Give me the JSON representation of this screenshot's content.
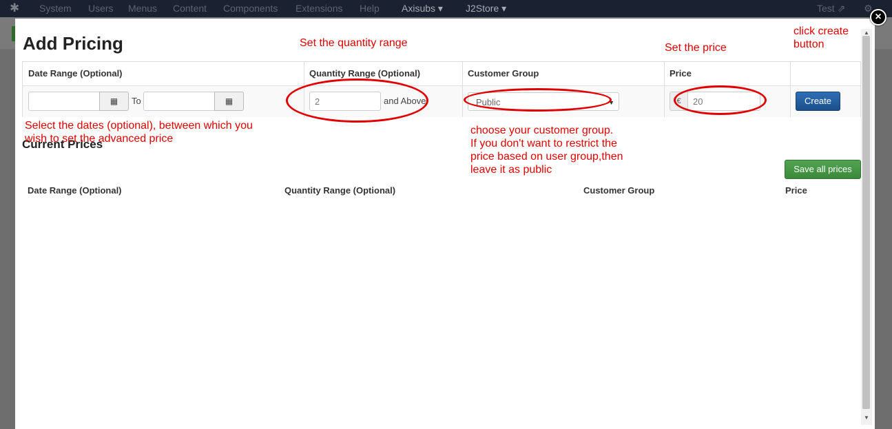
{
  "topbar": {
    "items": [
      "System",
      "Users",
      "Menus",
      "Content",
      "Components",
      "Extensions",
      "Help"
    ],
    "menu_axisubs": "Axisubs",
    "menu_j2store": "J2Store",
    "user": "Test"
  },
  "modal": {
    "title": "Add Pricing",
    "close_glyph": "×",
    "add_table": {
      "headers": {
        "date_range": "Date Range (Optional)",
        "quantity_range": "Quantity Range (Optional)",
        "customer_group": "Customer Group",
        "price": "Price"
      },
      "to_label": "To",
      "quantity_value": "2",
      "and_above": "and Above",
      "customer_group_value": "Public",
      "currency_symbol": "€",
      "price_value": "20",
      "create_label": "Create"
    },
    "current_prices": {
      "title": "Current Prices",
      "save_all_label": "Save all prices",
      "headers": {
        "date_range": "Date Range (Optional)",
        "quantity_range": "Quantity Range (Optional)",
        "customer_group": "Customer Group",
        "price": "Price"
      }
    }
  },
  "annotations": {
    "quantity": "Set the quantity range",
    "price": "Set the price",
    "create": "click create\nbutton",
    "dates": "Select the dates (optional), between which you\nwish to set the advanced price",
    "group": "choose your customer group.\nIf you don't want to restrict the\nprice based on user group,then\nleave it as public"
  },
  "colors": {
    "annotation": "#e00000",
    "create_button": "#1f5a9c",
    "save_button": "#46984a",
    "topbar": "#1a2131"
  },
  "icons": [
    "joomla-logo-icon",
    "calendar-icon",
    "gear-icon",
    "close-icon",
    "external-link-icon"
  ]
}
